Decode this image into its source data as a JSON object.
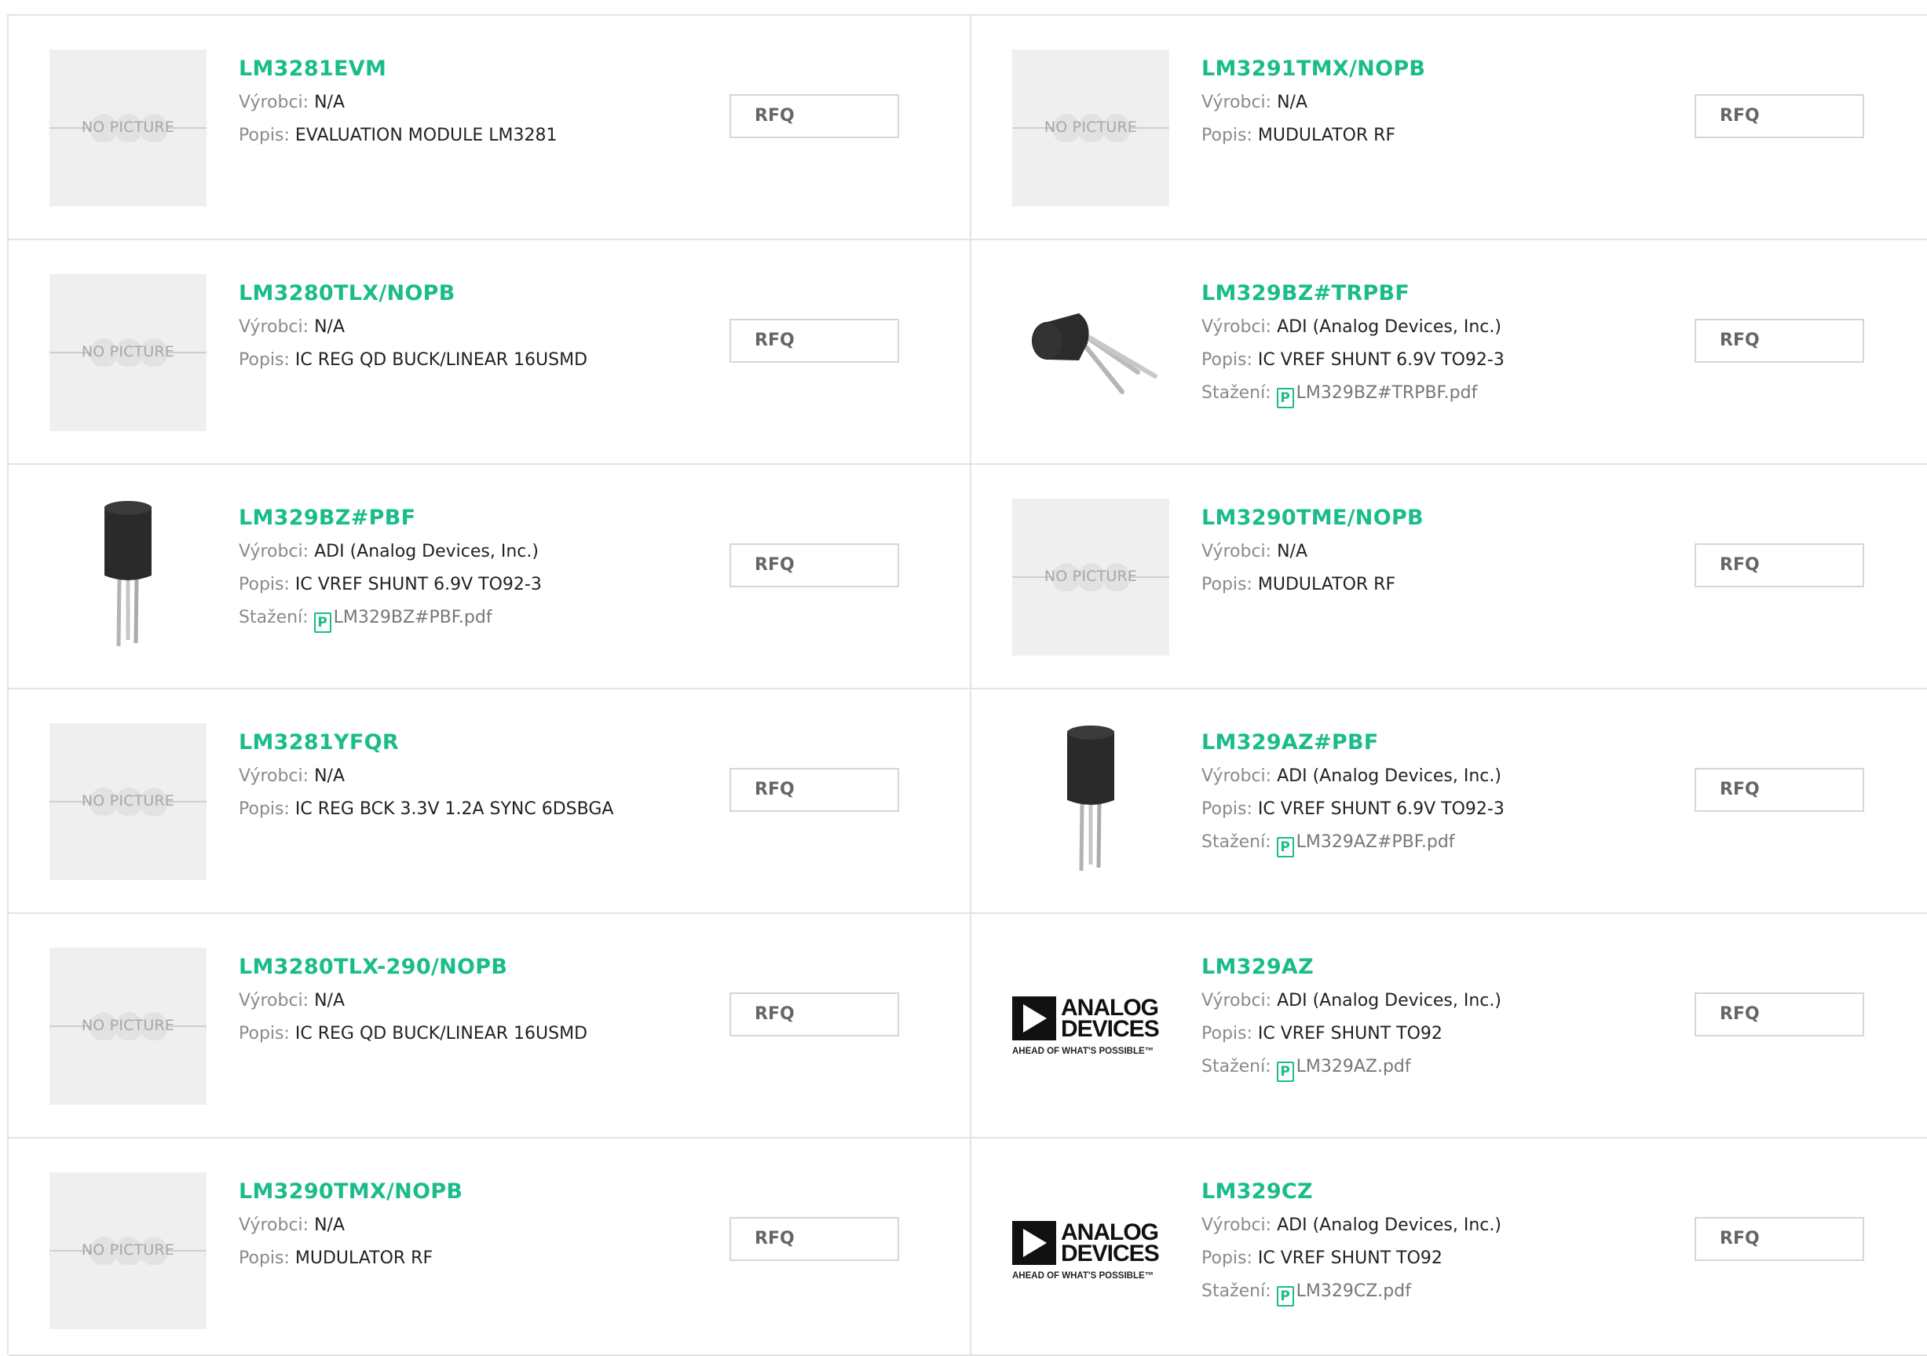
{
  "labels": {
    "manufacturer": "Výrobci:",
    "description": "Popis:",
    "download": "Stažení:",
    "rfq": "RFQ",
    "no_picture": "NO PICTURE"
  },
  "colors": {
    "accent": "#1abc8a",
    "border": "#e3e3e3",
    "placeholder_bg": "#efefef"
  },
  "products": [
    {
      "pn": "LM3281EVM",
      "manufacturer": "N/A",
      "description": "EVALUATION MODULE LM3281",
      "image": "no-picture"
    },
    {
      "pn": "LM3291TMX/NOPB",
      "manufacturer": "N/A",
      "description": "MUDULATOR RF",
      "image": "no-picture"
    },
    {
      "pn": "LM3280TLX/NOPB",
      "manufacturer": "N/A",
      "description": "IC REG QD BUCK/LINEAR 16USMD",
      "image": "no-picture"
    },
    {
      "pn": "LM329BZ#TRPBF",
      "manufacturer": "ADI (Analog Devices, Inc.)",
      "description": "IC VREF SHUNT 6.9V TO92-3",
      "download": "LM329BZ#TRPBF.pdf",
      "image": "to92-side"
    },
    {
      "pn": "LM329BZ#PBF",
      "manufacturer": "ADI (Analog Devices, Inc.)",
      "description": "IC VREF SHUNT 6.9V TO92-3",
      "download": "LM329BZ#PBF.pdf",
      "image": "to92-front"
    },
    {
      "pn": "LM3290TME/NOPB",
      "manufacturer": "N/A",
      "description": "MUDULATOR RF",
      "image": "no-picture"
    },
    {
      "pn": "LM3281YFQR",
      "manufacturer": "N/A",
      "description": "IC REG BCK 3.3V 1.2A SYNC 6DSBGA",
      "image": "no-picture"
    },
    {
      "pn": "LM329AZ#PBF",
      "manufacturer": "ADI (Analog Devices, Inc.)",
      "description": "IC VREF SHUNT 6.9V TO92-3",
      "download": "LM329AZ#PBF.pdf",
      "image": "to92-front"
    },
    {
      "pn": "LM3280TLX-290/NOPB",
      "manufacturer": "N/A",
      "description": "IC REG QD BUCK/LINEAR 16USMD",
      "image": "no-picture"
    },
    {
      "pn": "LM329AZ",
      "manufacturer": "ADI (Analog Devices, Inc.)",
      "description": "IC VREF SHUNT TO92",
      "download": "LM329AZ.pdf",
      "image": "adi-logo"
    },
    {
      "pn": "LM3290TMX/NOPB",
      "manufacturer": "N/A",
      "description": "MUDULATOR RF",
      "image": "no-picture"
    },
    {
      "pn": "LM329CZ",
      "manufacturer": "ADI (Analog Devices, Inc.)",
      "description": "IC VREF SHUNT TO92",
      "download": "LM329CZ.pdf",
      "image": "adi-logo"
    }
  ],
  "adi_logo": {
    "line1": "ANALOG",
    "line2": "DEVICES",
    "tagline": "AHEAD OF WHAT'S POSSIBLE™"
  }
}
